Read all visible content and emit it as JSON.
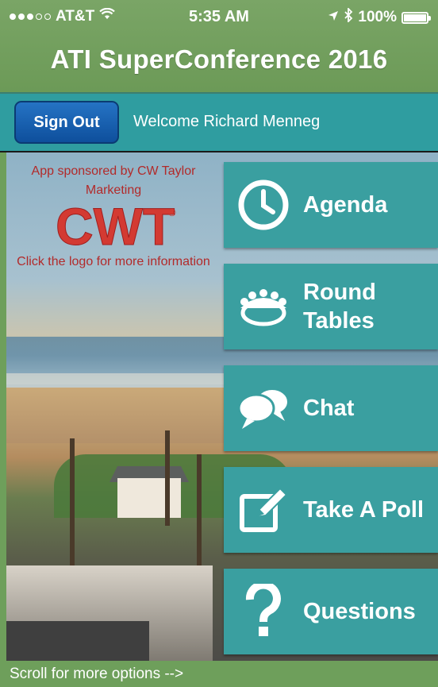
{
  "status_bar": {
    "carrier": "AT&T",
    "time": "5:35 AM",
    "battery": "100%",
    "signal_bars_filled": 3,
    "signal_bars_total": 5
  },
  "header": {
    "title": "ATI SuperConference 2016"
  },
  "user_bar": {
    "sign_out_label": "Sign Out",
    "welcome_text": "Welcome Richard Menneg"
  },
  "sponsor": {
    "text": "App sponsored by CW Taylor Marketing",
    "logo_text": "CWT",
    "logo_mark": "®",
    "more_info": "Click the logo for more information"
  },
  "menu": {
    "items": [
      {
        "label": "Agenda",
        "icon": "clock-icon"
      },
      {
        "label": "Round Tables",
        "icon": "round-table-icon"
      },
      {
        "label": "Chat",
        "icon": "chat-bubbles-icon"
      },
      {
        "label": "Take A Poll",
        "icon": "edit-pencil-icon"
      },
      {
        "label": "Questions",
        "icon": "question-mark-icon"
      }
    ]
  },
  "footer": {
    "scroll_hint": "Scroll for more options -->"
  },
  "colors": {
    "header_green": "#6e9f5b",
    "teal": "#3a9fa0",
    "button_blue": "#1560b0",
    "sponsor_red": "#b22a2a"
  }
}
